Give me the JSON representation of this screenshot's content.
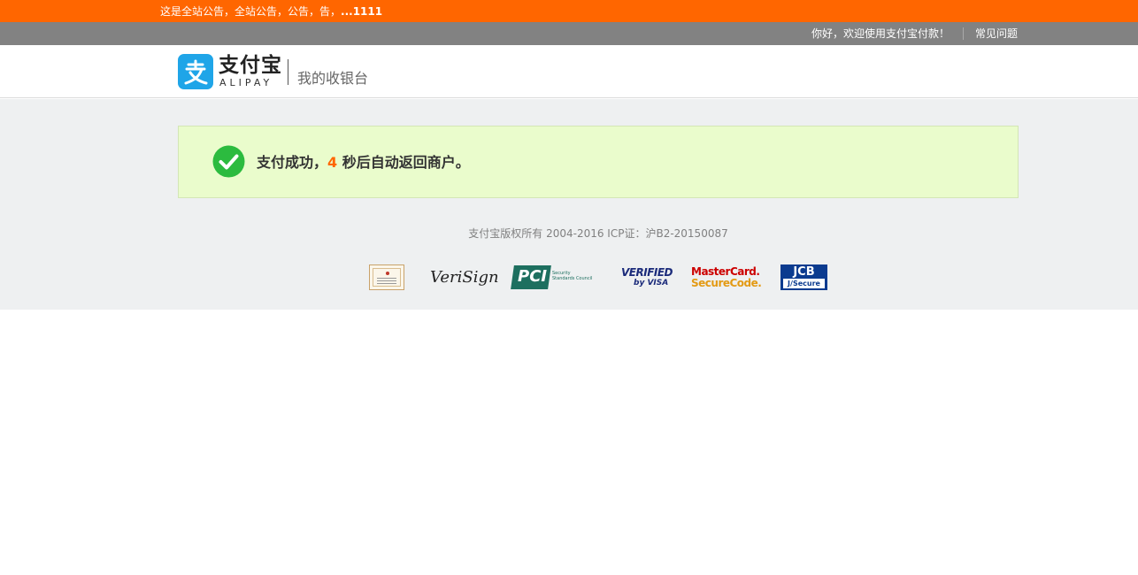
{
  "notice": {
    "text": "这是全站公告，全站公告，公告，告，",
    "suffix": "...1111"
  },
  "topbar": {
    "welcome": "你好，欢迎使用支付宝付款！",
    "faq_link": "常见问题"
  },
  "header": {
    "logo_cn": "支付宝",
    "logo_en": "ALIPAY",
    "cashier_title": "我的收银台"
  },
  "success": {
    "prefix": "支付成功，",
    "seconds": "4",
    "suffix": " 秒后自动返回商户。"
  },
  "footer": {
    "copyright": "支付宝版权所有 2004-2016 ICP证：沪B2-20150087"
  },
  "badges": {
    "verisign": "VeriSign",
    "pci_main": "PCI",
    "pci_sub_1": "Security",
    "pci_sub_2": "Standards Council",
    "visa_top": "VERIFIED",
    "visa_bottom": "by VISA",
    "mc_top": "MasterCard.",
    "mc_bottom": "SecureCode.",
    "jcb_top": "JCB",
    "jcb_bottom": "J/Secure"
  },
  "colors": {
    "notice_bg": "#ff6600",
    "topbar_bg": "#828282",
    "brand_blue": "#1fa5e8",
    "success_bg": "#eafccc",
    "success_icon": "#2cbb3f",
    "countdown": "#ff6600"
  }
}
